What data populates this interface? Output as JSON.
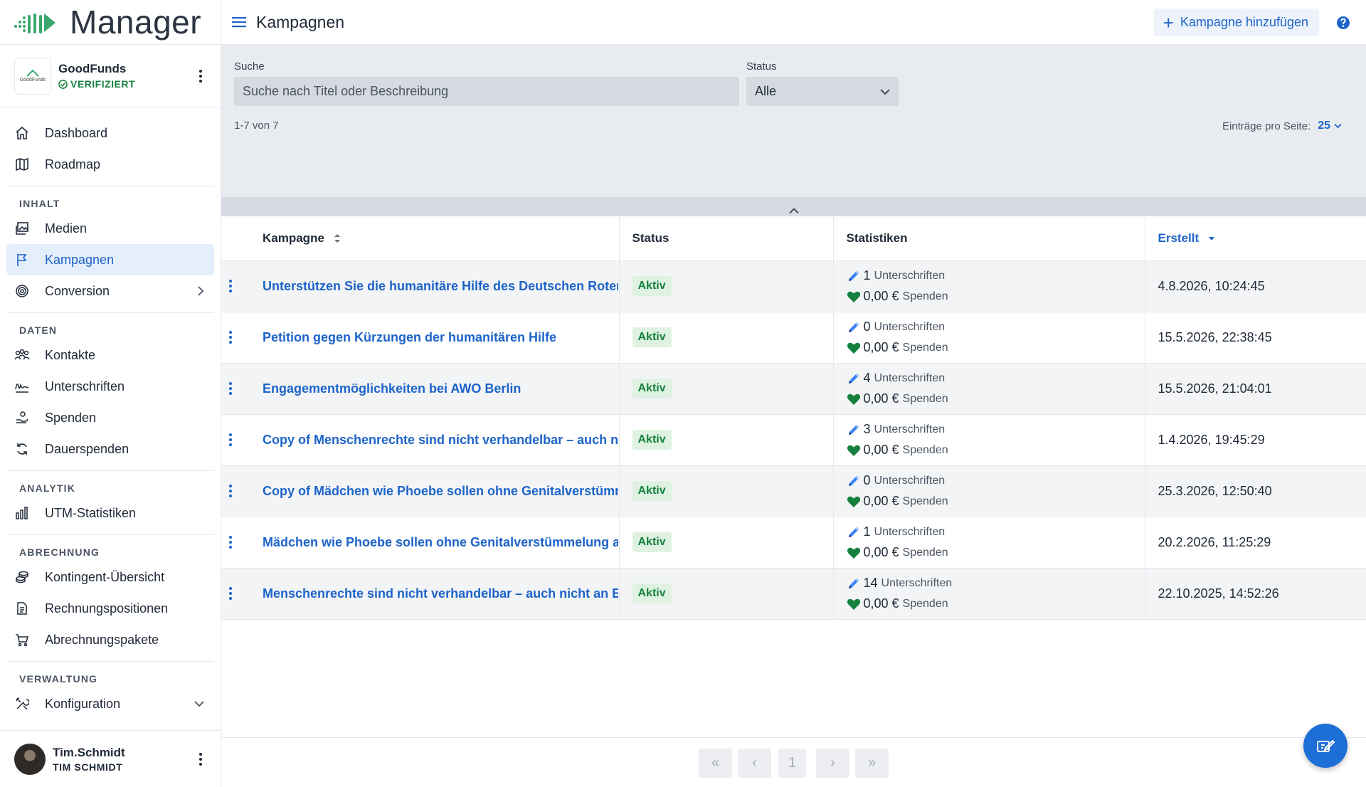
{
  "app": {
    "name": "Manager"
  },
  "org": {
    "name": "GoodFunds",
    "logo_text": "GoodFunds",
    "verified": "VERIFIZIERT"
  },
  "nav": {
    "top": [
      {
        "label": "Dashboard",
        "icon": "home-icon"
      },
      {
        "label": "Roadmap",
        "icon": "map-icon"
      }
    ],
    "sections": [
      {
        "label": "INHALT",
        "items": [
          {
            "label": "Medien",
            "icon": "images-icon"
          },
          {
            "label": "Kampagnen",
            "icon": "flag-icon",
            "active": true
          },
          {
            "label": "Conversion",
            "icon": "target-icon",
            "chevron": "chevron-right-icon"
          }
        ]
      },
      {
        "label": "DATEN",
        "items": [
          {
            "label": "Kontakte",
            "icon": "people-icon"
          },
          {
            "label": "Unterschriften",
            "icon": "signature-icon"
          },
          {
            "label": "Spenden",
            "icon": "donation-icon"
          },
          {
            "label": "Dauerspenden",
            "icon": "recurring-icon"
          }
        ]
      },
      {
        "label": "ANALYTIK",
        "items": [
          {
            "label": "UTM-Statistiken",
            "icon": "bar-chart-icon"
          }
        ]
      },
      {
        "label": "ABRECHNUNG",
        "items": [
          {
            "label": "Kontingent-Übersicht",
            "icon": "coins-icon"
          },
          {
            "label": "Rechnungspositionen",
            "icon": "invoice-icon"
          },
          {
            "label": "Abrechnungspakete",
            "icon": "cart-icon"
          }
        ]
      },
      {
        "label": "VERWALTUNG",
        "items": [
          {
            "label": "Konfiguration",
            "icon": "tools-icon",
            "chevron": "chevron-down-icon"
          }
        ]
      }
    ]
  },
  "user": {
    "name": "Tim.Schmidt",
    "full_name": "TIM SCHMIDT"
  },
  "header": {
    "title": "Kampagnen",
    "add_label": "Kampagne hinzufügen"
  },
  "filters": {
    "search_label": "Suche",
    "search_placeholder": "Suche nach Titel oder Beschreibung",
    "status_label": "Status",
    "status_value": "Alle",
    "range": "1-7 von 7",
    "per_page_label": "Einträge pro Seite:",
    "per_page_value": "25"
  },
  "table": {
    "columns": [
      "Kampagne",
      "Status",
      "Statistiken",
      "Erstellt"
    ],
    "signatures_label": "Unterschriften",
    "donations_label": "Spenden",
    "rows": [
      {
        "title": "Unterstützen Sie die humanitäre Hilfe des Deutschen Roten Kreuzes",
        "status": "Aktiv",
        "signatures": "1",
        "donations": "0,00 €",
        "created": "4.8.2026, 10:24:45"
      },
      {
        "title": "Petition gegen Kürzungen der humanitären Hilfe",
        "status": "Aktiv",
        "signatures": "0",
        "donations": "0,00 €",
        "created": "15.5.2026, 22:38:45"
      },
      {
        "title": "Engagementmöglichkeiten bei AWO Berlin",
        "status": "Aktiv",
        "signatures": "4",
        "donations": "0,00 €",
        "created": "15.5.2026, 21:04:01"
      },
      {
        "title": "Copy of Menschenrechte sind nicht verhandelbar – auch nicht an Europas Grenzen",
        "status": "Aktiv",
        "signatures": "3",
        "donations": "0,00 €",
        "created": "1.4.2026, 19:45:29"
      },
      {
        "title": "Copy of Mädchen wie Phoebe sollen ohne Genitalverstümmelung aufwachsen",
        "status": "Aktiv",
        "signatures": "0",
        "donations": "0,00 €",
        "created": "25.3.2026, 12:50:40"
      },
      {
        "title": "Mädchen wie Phoebe sollen ohne Genitalverstümmelung aufwachsen",
        "status": "Aktiv",
        "signatures": "1",
        "donations": "0,00 €",
        "created": "20.2.2026, 11:25:29"
      },
      {
        "title": "Menschenrechte sind nicht verhandelbar – auch nicht an Europas Grenzen",
        "status": "Aktiv",
        "signatures": "14",
        "donations": "0,00 €",
        "created": "22.10.2025, 14:52:26"
      }
    ]
  },
  "pagination": {
    "current": "1",
    "first": "«",
    "prev": "‹",
    "next": "›",
    "last": "»"
  },
  "colors": {
    "accent": "#1d64c9",
    "success": "#15803d",
    "badge_bg": "#dff2e1",
    "filter_bg": "#e8ebf0",
    "fab": "#1d6fd6"
  }
}
